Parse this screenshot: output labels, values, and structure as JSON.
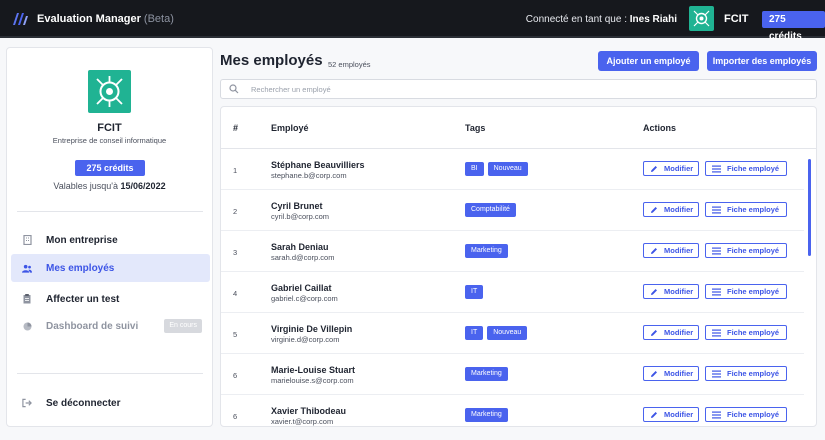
{
  "topbar": {
    "brand": "Evaluation Manager",
    "beta": "(Beta)",
    "connected_prefix": "Connecté en tant que :",
    "user": "Ines Riahi",
    "company": "FCIT",
    "credits": "275 crédits",
    "logo_color": "#20b393"
  },
  "sidebar": {
    "company": "FCIT",
    "description": "Entreprise de conseil informatique",
    "credits": "275 crédits",
    "valid_prefix": "Valables jusqu'à",
    "valid_date": "15/06/2022",
    "nav": [
      {
        "label": "Mon entreprise",
        "icon": "building-icon"
      },
      {
        "label": "Mes employés",
        "icon": "users-icon",
        "active": true
      },
      {
        "label": "Affecter un test",
        "icon": "clipboard-icon"
      },
      {
        "label": "Dashboard de suivi",
        "icon": "pie-chart-icon",
        "badge": "En cours"
      }
    ],
    "logout": "Se déconnecter"
  },
  "main": {
    "title": "Mes employés",
    "count": "52 employés",
    "add_button": "Ajouter un employé",
    "import_button": "Importer des employés",
    "search_placeholder": "Rechercher un employé",
    "columns": [
      "#",
      "Employé",
      "Tags",
      "Actions"
    ],
    "action_edit": "Modifier",
    "action_sheet": "Fiche employé",
    "rows": [
      {
        "num": "1",
        "name": "Stéphane Beauvilliers",
        "email": "stephane.b@corp.com",
        "tags": [
          "BI",
          "Nouveau"
        ]
      },
      {
        "num": "2",
        "name": "Cyril Brunet",
        "email": "cyril.b@corp.com",
        "tags": [
          "Comptabilité"
        ]
      },
      {
        "num": "3",
        "name": "Sarah Deniau",
        "email": "sarah.d@corp.com",
        "tags": [
          "Marketing"
        ]
      },
      {
        "num": "4",
        "name": "Gabriel Caillat",
        "email": "gabriel.c@corp.com",
        "tags": [
          "IT"
        ]
      },
      {
        "num": "5",
        "name": "Virginie De Villepin",
        "email": "virginie.d@corp.com",
        "tags": [
          "IT",
          "Nouveau"
        ]
      },
      {
        "num": "6",
        "name": "Marie-Louise Stuart",
        "email": "marielouise.s@corp.com",
        "tags": [
          "Marketing"
        ]
      },
      {
        "num": "6",
        "name": "Xavier Thibodeau",
        "email": "xavier.t@corp.com",
        "tags": [
          "Marketing"
        ]
      }
    ]
  },
  "colors": {
    "accent": "#4a63ee",
    "brand_green": "#20b393",
    "topbar": "#16181d"
  }
}
